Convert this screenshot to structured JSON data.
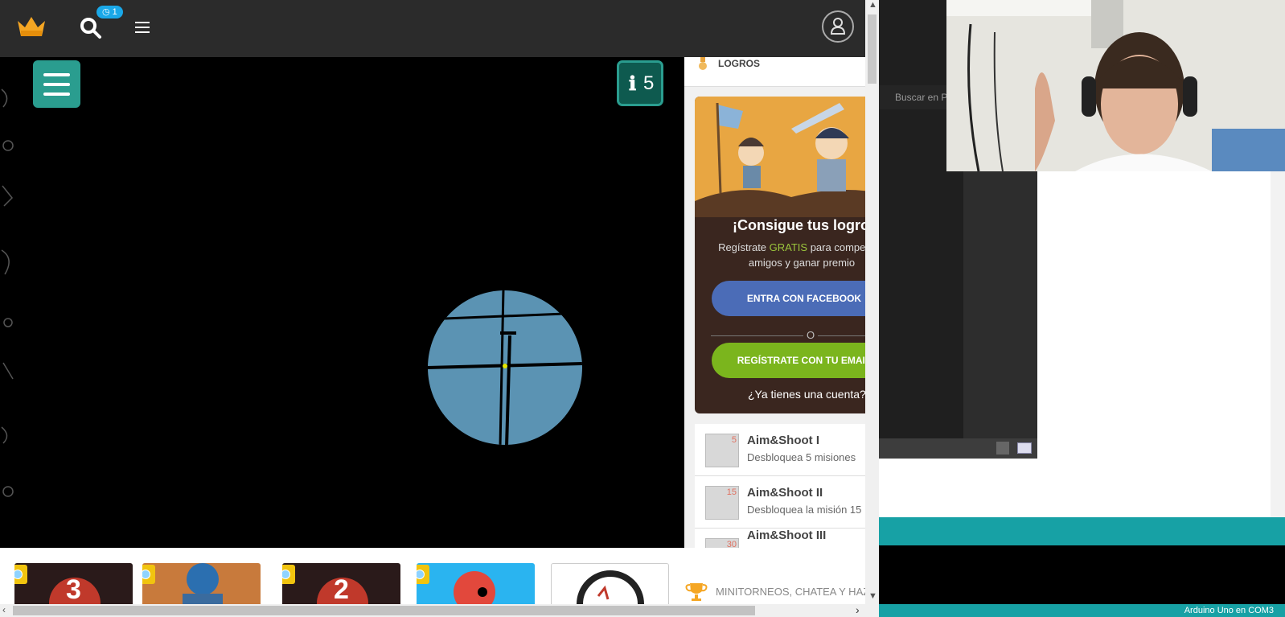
{
  "header": {
    "notification_count": "1",
    "notification_prefix": "◷"
  },
  "game": {
    "ammo_count": "5",
    "ammo_icon": "ℹ"
  },
  "achievements": {
    "section_title": "LOGROS",
    "promo_title": "¡Consigue tus logros",
    "promo_text_before": "Regístrate ",
    "promo_text_highlight": "GRATIS",
    "promo_text_after": " para compet tus amigos y ganar premio",
    "facebook_button": "ENTRA CON FACEBOOK",
    "or_text": "O",
    "email_button": "REGÍSTRATE CON TU EMAIL",
    "have_account": "¿Ya tienes una cuenta?",
    "items": [
      {
        "title": "Aim&Shoot I",
        "desc": "Desbloquea 5 misiones",
        "badge": "5"
      },
      {
        "title": "Aim&Shoot II",
        "desc": "Desbloquea la misión 15",
        "badge": "15"
      },
      {
        "title": "Aim&Shoot III",
        "desc": "",
        "badge": "30"
      }
    ]
  },
  "strip": {
    "label": "MINITORNEOS, CHATEA Y HAZ A",
    "thumbs": [
      {
        "label": "3"
      },
      {
        "label": ""
      },
      {
        "label": "2"
      },
      {
        "label": ""
      },
      {
        "label": ""
      }
    ]
  },
  "desktop": {
    "ide_search": "Buscar en P¿",
    "status": "Arduino Uno en COM3"
  },
  "colors": {
    "teal": "#2a9d8f",
    "facebook": "#4b6cb7",
    "email": "#7bb51d",
    "scope": "#5b93b3",
    "arduino_teal": "#17a1a5"
  }
}
